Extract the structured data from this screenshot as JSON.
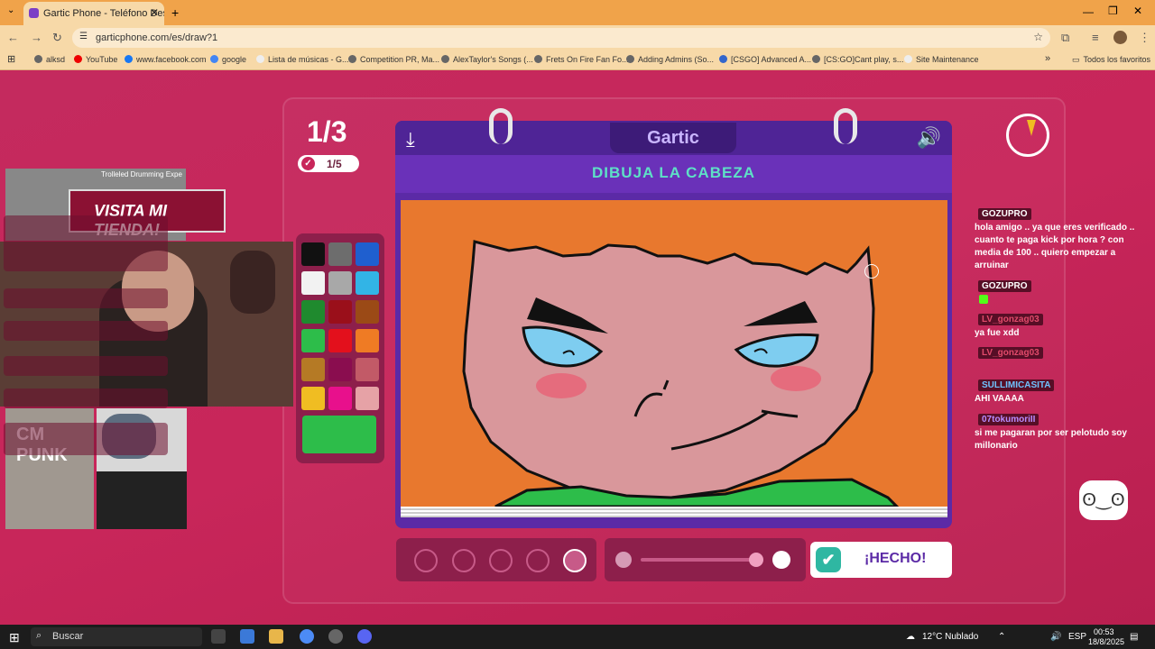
{
  "browser": {
    "tab_title": "Gartic Phone - Teléfono Descon",
    "url": "garticphone.com/es/draw?1",
    "bookmarks": [
      "alksd",
      "YouTube",
      "www.facebook.com",
      "google",
      "Lista de músicas - G...",
      "Competition PR, Ma...",
      "AlexTaylor's Songs (...",
      "Frets On Fire Fan Fo...",
      "Adding Admins (So...",
      "[CSGO] Advanced A...",
      "[CS:GO]Cant play, s...",
      "Site Maintenance"
    ],
    "all_favorites": "Todos los favoritos"
  },
  "game": {
    "round": "1/3",
    "progress": "1/5",
    "logo": "Gartic",
    "prompt": "DIBUJA LA CABEZA",
    "done_label": "¡HECHO!",
    "selected_color": "#2dbd4a",
    "palette": [
      "#111111",
      "#6d6d6d",
      "#1f5fcf",
      "#f2f2f2",
      "#a8a8a8",
      "#32b4e6",
      "#1f8a2e",
      "#9a0f1a",
      "#9b4a16",
      "#2dbd4a",
      "#e3101c",
      "#ef7b24",
      "#b57a25",
      "#8a0d4f",
      "#c25a67",
      "#f0bd22",
      "#e8108c",
      "#e6a2a6"
    ],
    "pen_sizes": 5,
    "selected_pen_index": 4
  },
  "overlay": {
    "banner": "VISITA MI TIENDA!",
    "stream_title": "Trolleled Drumming Expe",
    "punk_text": "CM PUNK"
  },
  "chat": [
    {
      "user": "GOZUPRO",
      "color": "#ffffff",
      "text": "hola amigo .. ya que eres verificado .. cuanto te paga kick por hora ? con media de 100 .. quiero empezar a arruinar"
    },
    {
      "user": "GOZUPRO",
      "color": "#ffffff",
      "text": ""
    },
    {
      "user": "LV_gonzag03",
      "color": "#e24a6b",
      "text": "ya fue xdd"
    },
    {
      "user": "LV_gonzag03",
      "color": "#e24a6b",
      "text": ""
    },
    {
      "user": "SULLIMICASITA",
      "color": "#6ec3ff",
      "text": "AHI VAAAA"
    },
    {
      "user": "07tokumoriII",
      "color": "#b98cff",
      "text": "si me pagaran por ser pelotudo soy millonario"
    }
  ],
  "taskbar": {
    "search": "Buscar",
    "weather": "12°C  Nublado",
    "lang": "ESP",
    "time": "00:53",
    "date": "18/8/2025"
  }
}
